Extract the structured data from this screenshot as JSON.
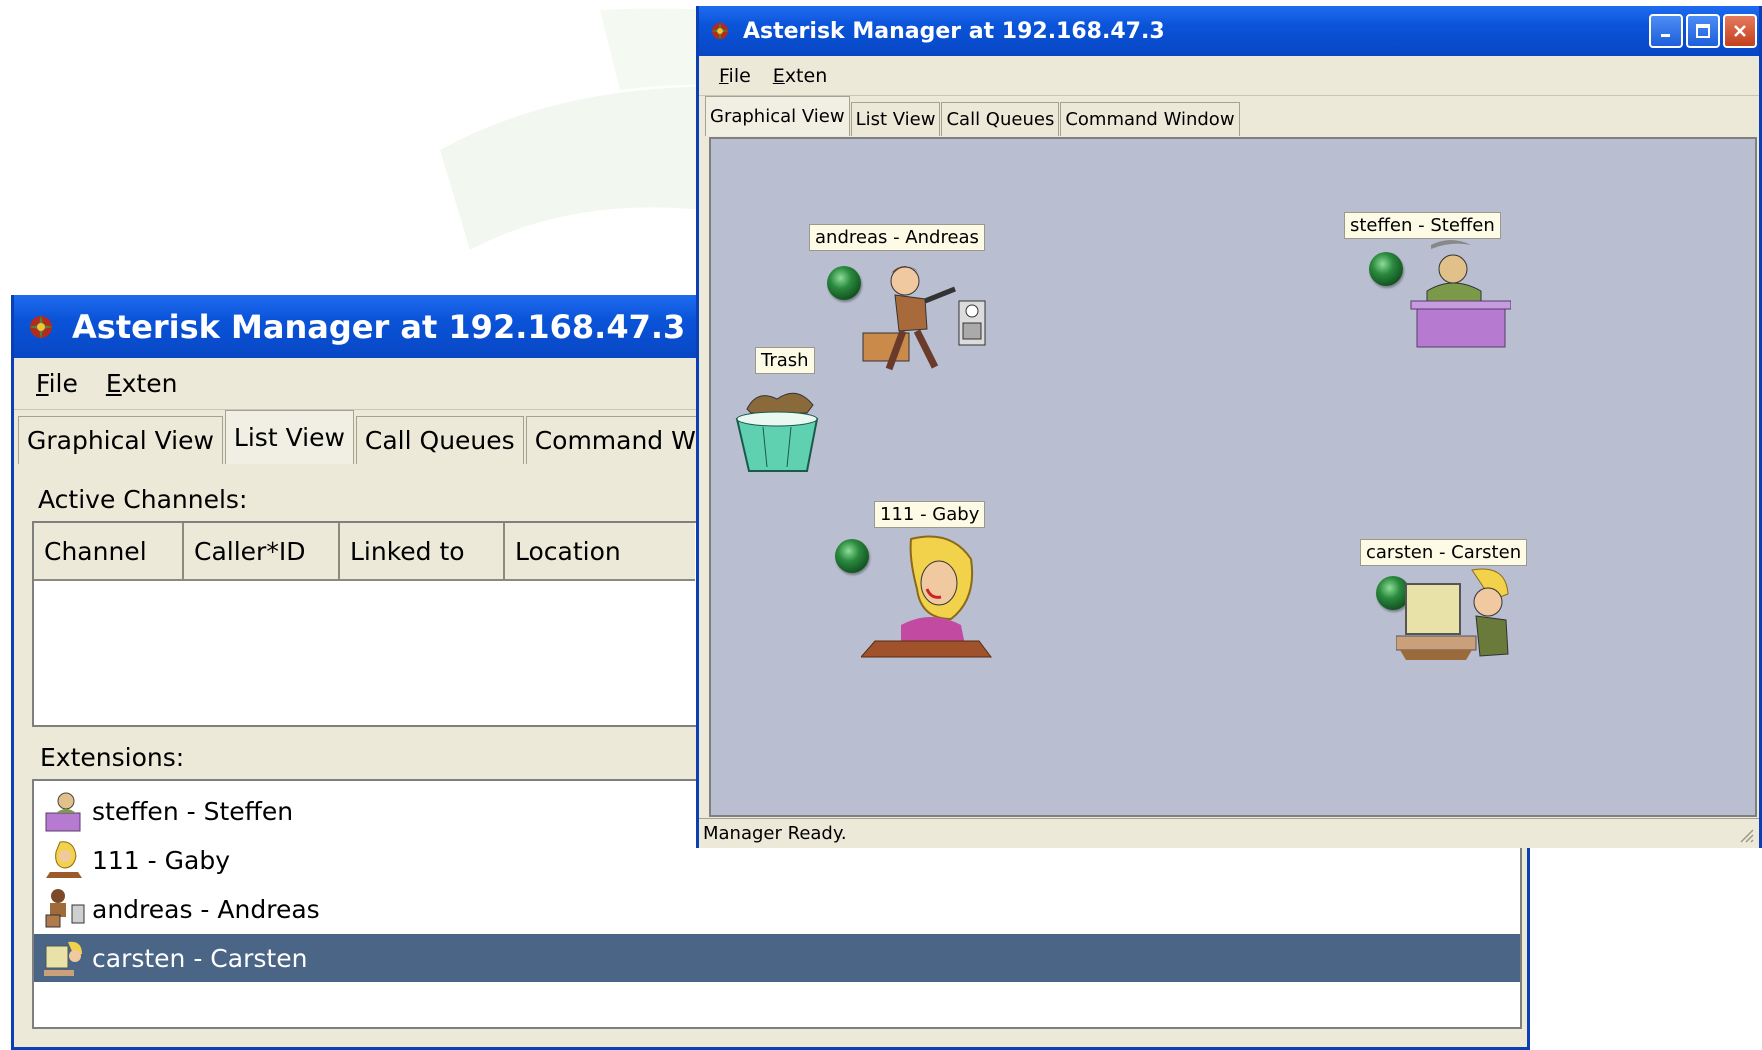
{
  "back_window": {
    "title": "Asterisk Manager at 192.168.47.3",
    "menu": [
      {
        "accel": "F",
        "rest": "ile"
      },
      {
        "accel": "E",
        "rest": "xten"
      }
    ],
    "tabs": [
      "Graphical View",
      "List View",
      "Call Queues",
      "Command Window"
    ],
    "active_tab": "List View",
    "active_channels_label": "Active Channels:",
    "columns": [
      "Channel",
      "Caller*ID",
      "Linked to",
      "Location"
    ],
    "extensions_label": "Extensions:",
    "extensions": [
      {
        "label": "steffen - Steffen",
        "icon": "desk-man-icon"
      },
      {
        "label": "111 - Gaby",
        "icon": "phone-woman-icon"
      },
      {
        "label": "andreas - Andreas",
        "icon": "running-man-icon"
      },
      {
        "label": "carsten - Carsten",
        "icon": "computer-man-icon",
        "selected": true
      }
    ]
  },
  "front_window": {
    "title": "Asterisk Manager at 192.168.47.3",
    "menu": [
      {
        "accel": "F",
        "rest": "ile"
      },
      {
        "accel": "E",
        "rest": "xten"
      }
    ],
    "tabs": [
      "Graphical View",
      "List View",
      "Call Queues",
      "Command Window"
    ],
    "active_tab": "Graphical View",
    "canvas_items": {
      "andreas": "andreas - Andreas",
      "steffen": "steffen - Steffen",
      "trash": "Trash",
      "gaby": "111 - Gaby",
      "carsten": "carsten - Carsten"
    },
    "status": "Manager Ready."
  },
  "colors": {
    "title_blue": "#0a53d8",
    "selection": "#4a6585",
    "canvas_bg": "#b9bfd1",
    "status_led": "#2a8a3e"
  }
}
